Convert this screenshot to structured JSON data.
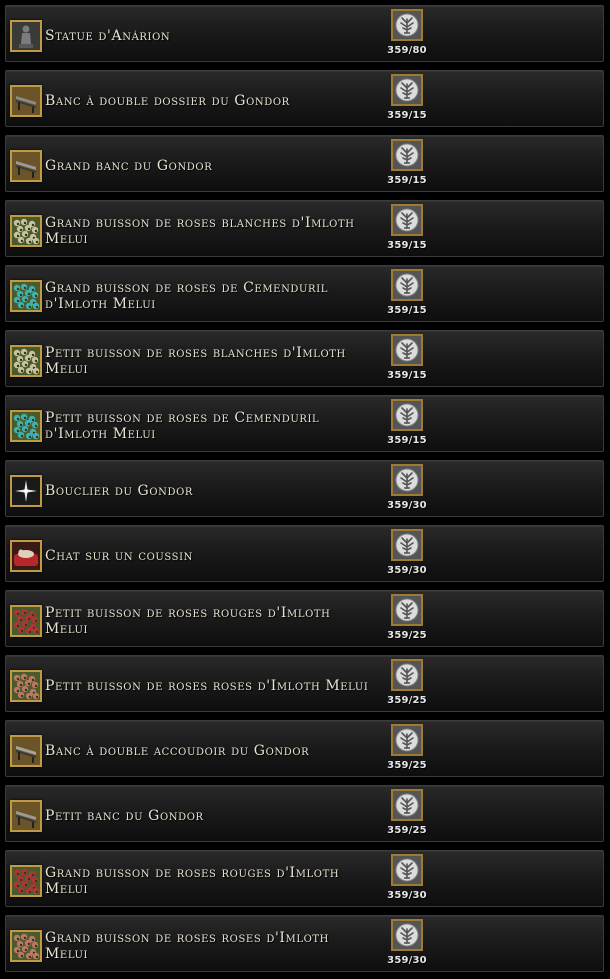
{
  "items": [
    {
      "name": "Statue d'Anárion",
      "cost": "359/80",
      "icon": "statue-icon",
      "icon_color": "#7c7c80"
    },
    {
      "name": "Banc à double dossier du Gondor",
      "cost": "359/15",
      "icon": "bench-icon",
      "icon_color": "#8a8a86"
    },
    {
      "name": "Grand banc du Gondor",
      "cost": "359/15",
      "icon": "bench-icon",
      "icon_color": "#9a9a94"
    },
    {
      "name": "Grand buisson de roses blanches d'Imloth Melui",
      "cost": "359/15",
      "icon": "white-rose-bush-icon",
      "icon_color": "#cfc8a8"
    },
    {
      "name": "Grand buisson de roses de Cemenduril d'Imloth Melui",
      "cost": "359/15",
      "icon": "cyan-rose-bush-icon",
      "icon_color": "#3fb6b8"
    },
    {
      "name": "Petit buisson de roses blanches d'Imloth Melui",
      "cost": "359/15",
      "icon": "white-rose-bush-icon",
      "icon_color": "#cfc8a8"
    },
    {
      "name": "Petit buisson de roses de Cemenduril d'Imloth Melui",
      "cost": "359/15",
      "icon": "cyan-rose-bush-icon",
      "icon_color": "#3fb6b8"
    },
    {
      "name": "Bouclier du Gondor",
      "cost": "359/30",
      "icon": "shield-icon",
      "icon_color": "#1a1a1a"
    },
    {
      "name": "Chat sur un coussin",
      "cost": "359/30",
      "icon": "cat-cushion-icon",
      "icon_color": "#b8282a"
    },
    {
      "name": "Petit buisson de roses rouges d'Imloth Melui",
      "cost": "359/25",
      "icon": "red-rose-bush-icon",
      "icon_color": "#b4343a"
    },
    {
      "name": "Petit buisson de roses roses d'Imloth Melui",
      "cost": "359/25",
      "icon": "pink-rose-bush-icon",
      "icon_color": "#c27a6a"
    },
    {
      "name": "Banc à double accoudoir du Gondor",
      "cost": "359/25",
      "icon": "bench-icon",
      "icon_color": "#a4a4a0"
    },
    {
      "name": "Petit banc du Gondor",
      "cost": "359/25",
      "icon": "bench-icon",
      "icon_color": "#9a9a94"
    },
    {
      "name": "Grand buisson de roses rouges d'Imloth Melui",
      "cost": "359/30",
      "icon": "red-rose-bush-icon",
      "icon_color": "#b4343a"
    },
    {
      "name": "Grand buisson de roses roses d'Imloth Melui",
      "cost": "359/30",
      "icon": "pink-rose-bush-icon",
      "icon_color": "#c27a6a"
    }
  ],
  "currency_icon": "white-tree-token-icon",
  "colors": {
    "item_frame": "#c09a45",
    "text": "#e8e2d0"
  }
}
